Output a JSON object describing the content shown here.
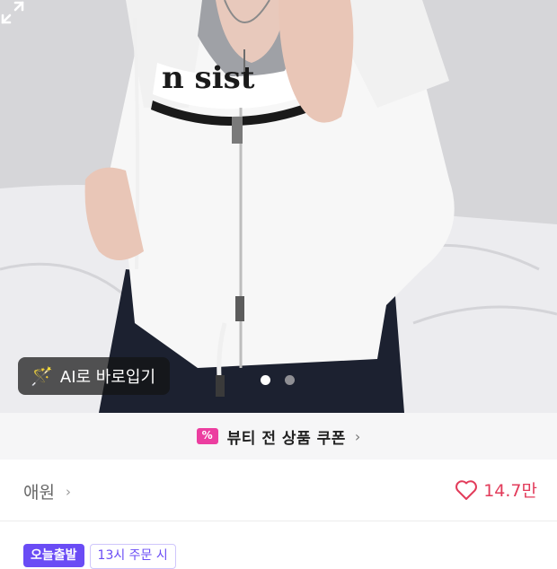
{
  "photo": {
    "ai_button_label": "AI로 바로입기",
    "ai_icon": "magic-wand-icon",
    "carousel": {
      "count": 2,
      "active_index": 0
    },
    "expand_icon": "expand-icon"
  },
  "coupon_banner": {
    "icon": "coupon-ticket-icon",
    "icon_glyph": "%",
    "label": "뷰티 전 상품 쿠폰",
    "chevron": "›"
  },
  "seller": {
    "name": "애원",
    "chevron": "›"
  },
  "likes": {
    "icon": "heart-icon",
    "count": "14.7만",
    "color": "#e23b5a"
  },
  "badges": {
    "today": "오늘출발",
    "order": "13시 주문 시"
  },
  "colors": {
    "accent_pink": "#ec3ea0",
    "accent_purple": "#6a4cf5"
  }
}
